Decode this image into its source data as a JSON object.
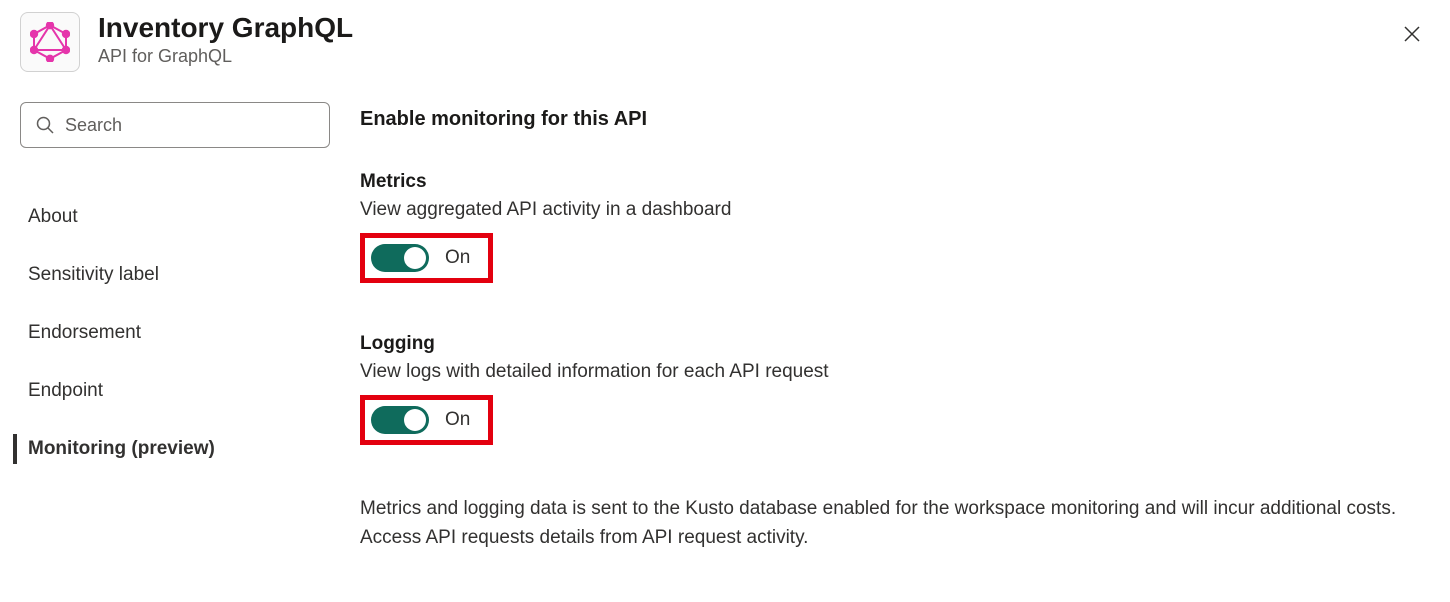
{
  "header": {
    "title": "Inventory GraphQL",
    "subtitle": "API for GraphQL"
  },
  "sidebar": {
    "search_placeholder": "Search",
    "items": [
      {
        "label": "About",
        "active": false
      },
      {
        "label": "Sensitivity label",
        "active": false
      },
      {
        "label": "Endorsement",
        "active": false
      },
      {
        "label": "Endpoint",
        "active": false
      },
      {
        "label": "Monitoring (preview)",
        "active": true
      }
    ]
  },
  "content": {
    "section_title": "Enable monitoring for this API",
    "metrics": {
      "heading": "Metrics",
      "description": "View aggregated API activity in a dashboard",
      "toggle_state": "On"
    },
    "logging": {
      "heading": "Logging",
      "description": "View logs with detailed information for each API request",
      "toggle_state": "On"
    },
    "footer_note": "Metrics and logging data is sent to the Kusto database enabled for the workspace monitoring and will incur additional costs. Access API requests details from API request activity."
  },
  "colors": {
    "highlight": "#e3000f",
    "toggle_on": "#0f6b5c",
    "graphql_pink": "#e535ab"
  }
}
